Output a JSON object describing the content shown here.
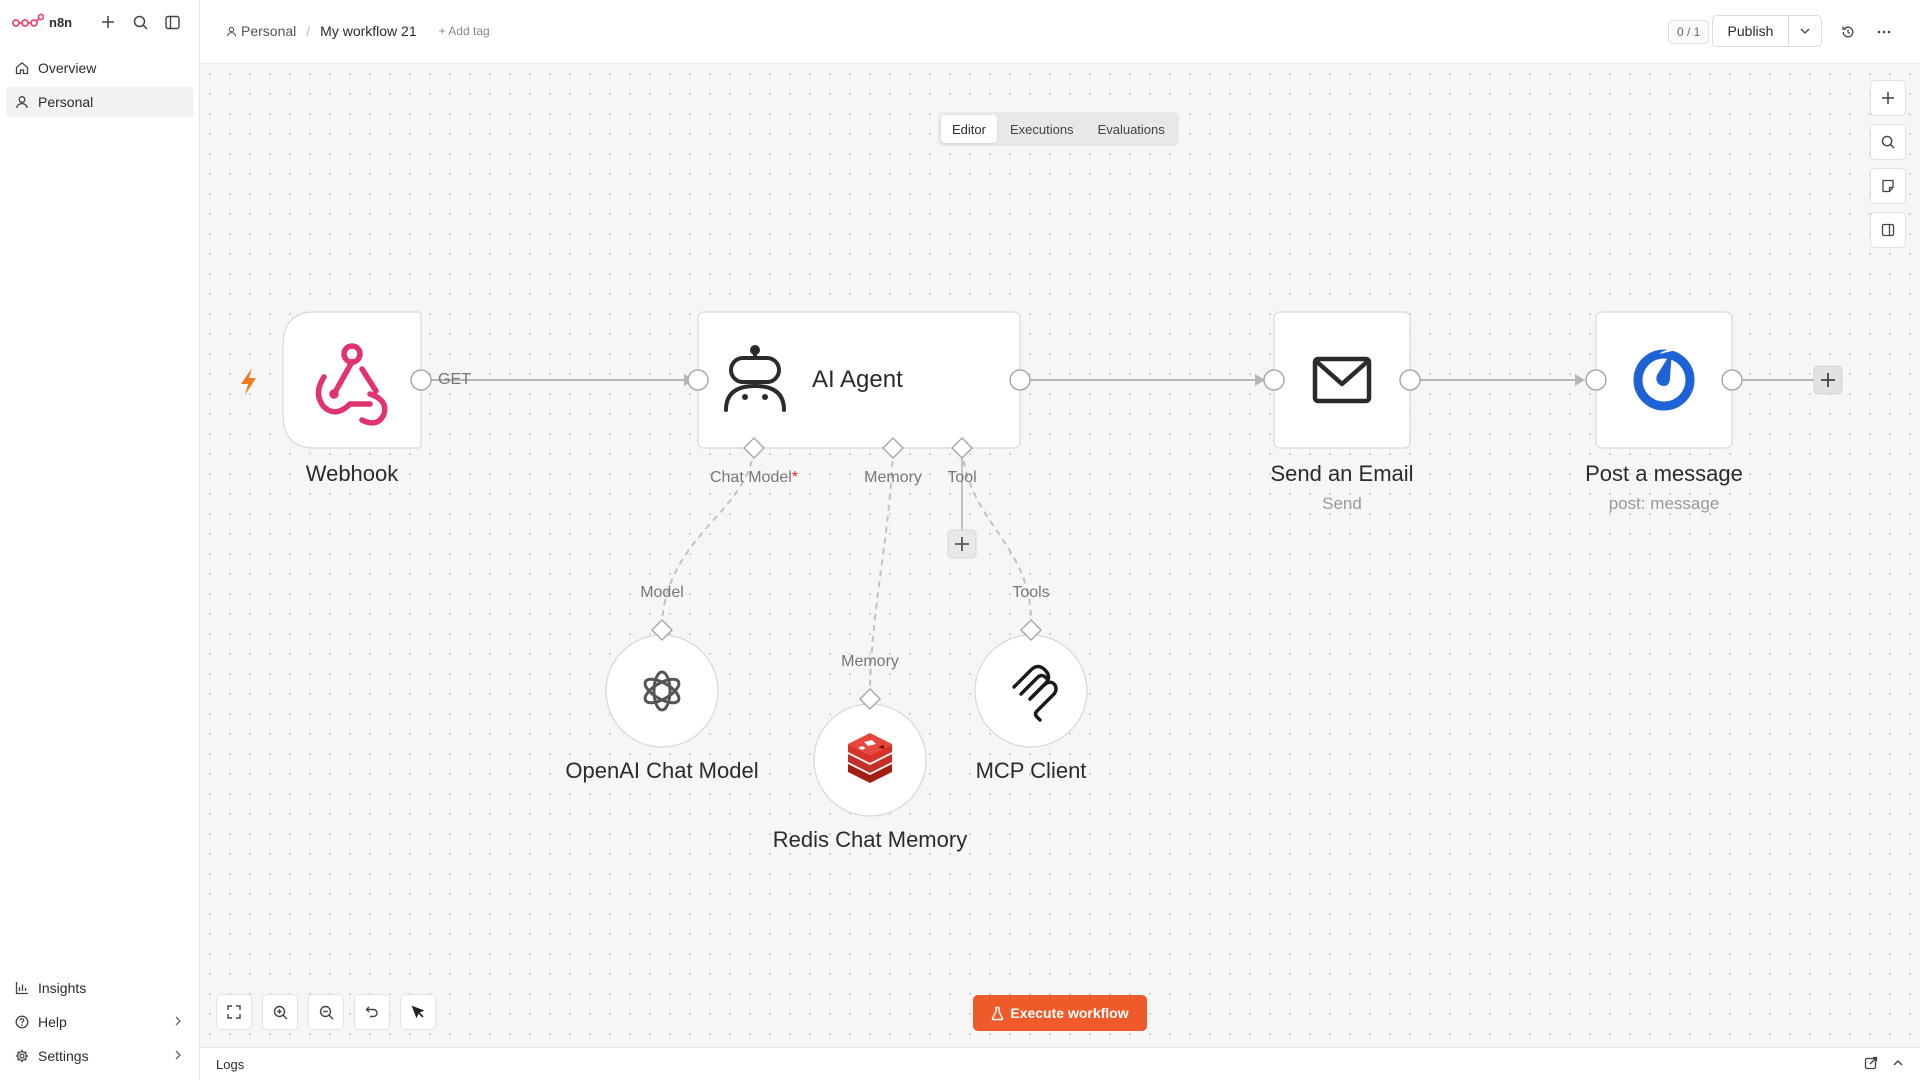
{
  "app": {
    "name": "n8n"
  },
  "sidebar": {
    "items": [
      {
        "label": "Overview"
      },
      {
        "label": "Personal"
      }
    ],
    "bottom_items": [
      {
        "label": "Insights"
      },
      {
        "label": "Help"
      },
      {
        "label": "Settings"
      }
    ]
  },
  "header": {
    "project": "Personal",
    "workflow_name": "My workflow 21",
    "add_tag": "+ Add tag",
    "counter": "0 / 1",
    "publish_label": "Publish"
  },
  "tabs": [
    {
      "label": "Editor",
      "active": true
    },
    {
      "label": "Executions",
      "active": false
    },
    {
      "label": "Evaluations",
      "active": false
    }
  ],
  "nodes": {
    "webhook": {
      "label": "Webhook",
      "output": "GET"
    },
    "agent": {
      "label": "AI Agent",
      "ports": {
        "chat_model": "Chat Model",
        "required_mark": "*",
        "memory": "Memory",
        "tool": "Tool"
      }
    },
    "email": {
      "label": "Send an Email",
      "sub": "Send"
    },
    "post": {
      "label": "Post a message",
      "sub": "post: message"
    },
    "openai": {
      "label": "OpenAI Chat Model",
      "port": "Model"
    },
    "redis": {
      "label": "Redis Chat Memory",
      "port": "Memory"
    },
    "mcp": {
      "label": "MCP Client",
      "port": "Tools"
    }
  },
  "execute_label": "Execute workflow",
  "logs_label": "Logs",
  "colors": {
    "accent": "#ee5a2a",
    "webhook_pink": "#e0336f",
    "redis_red": "#d8322b",
    "post_blue": "#1e63d6",
    "trigger_orange": "#ee7a24"
  }
}
